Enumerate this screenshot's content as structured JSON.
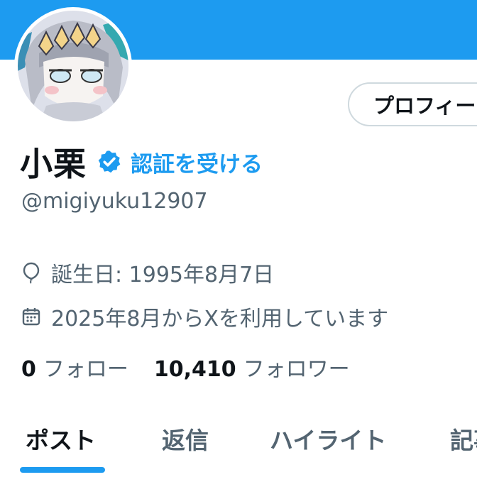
{
  "profile": {
    "edit_button_label": "プロフィー",
    "display_name": "小栗",
    "verify_link": "認証を受ける",
    "handle": "@migiyuku12907",
    "birthday": "誕生日: 1995年8月7日",
    "joined": "2025年8月からXを利用しています"
  },
  "stats": {
    "following_count": "0",
    "following_label": "フォロー",
    "followers_count": "10,410",
    "followers_label": "フォロワー"
  },
  "tabs": [
    {
      "label": "ポスト",
      "active": true
    },
    {
      "label": "返信",
      "active": false
    },
    {
      "label": "ハイライト",
      "active": false
    },
    {
      "label": "記事",
      "active": false
    }
  ],
  "colors": {
    "accent": "#1d9bf0",
    "text_primary": "#0f1419",
    "text_secondary": "#536471",
    "border": "#cfd9de"
  },
  "icons": {
    "verified": "verified-badge-icon",
    "birthday": "balloon-icon",
    "joined": "calendar-icon"
  }
}
